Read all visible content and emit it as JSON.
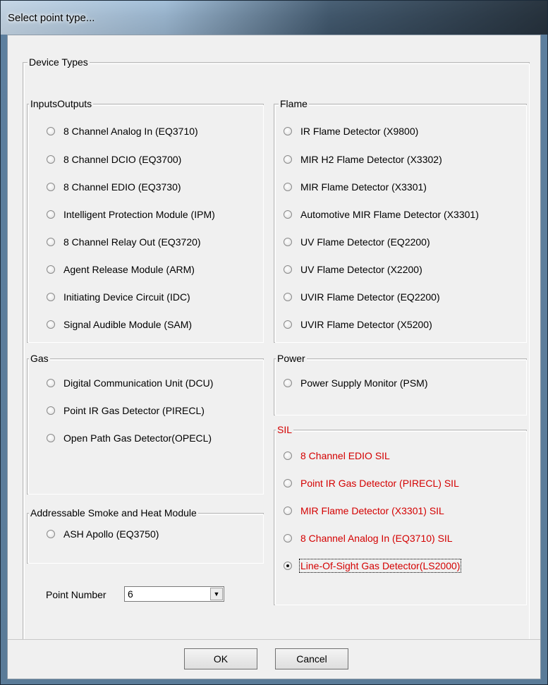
{
  "window": {
    "title": "Select point type..."
  },
  "device_types": {
    "label": "Device Types",
    "groups": {
      "inputs_outputs": {
        "label": "InputsOutputs",
        "options": [
          "8 Channel Analog In (EQ3710)",
          "8 Channel DCIO (EQ3700)",
          "8 Channel EDIO (EQ3730)",
          "Intelligent Protection Module (IPM)",
          "8 Channel Relay Out (EQ3720)",
          "Agent Release Module (ARM)",
          "Initiating Device Circuit (IDC)",
          "Signal Audible Module (SAM)"
        ]
      },
      "flame": {
        "label": "Flame",
        "options": [
          "IR Flame Detector (X9800)",
          "MIR H2 Flame Detector (X3302)",
          "MIR Flame Detector (X3301)",
          "Automotive MIR Flame Detector (X3301)",
          "UV Flame Detector (EQ2200)",
          "UV Flame Detector (X2200)",
          "UVIR Flame Detector (EQ2200)",
          "UVIR Flame Detector (X5200)"
        ]
      },
      "gas": {
        "label": "Gas",
        "options": [
          "Digital Communication Unit (DCU)",
          "Point IR Gas Detector (PIRECL)",
          "Open Path Gas Detector(OPECL)"
        ]
      },
      "power": {
        "label": "Power",
        "options": [
          "Power Supply Monitor (PSM)"
        ]
      },
      "smoke_heat": {
        "label": "Addressable Smoke and Heat Module",
        "options": [
          "ASH Apollo (EQ3750)"
        ]
      },
      "sil": {
        "label": "SIL",
        "options": [
          "8 Channel EDIO SIL",
          "Point IR Gas Detector (PIRECL) SIL",
          "MIR Flame Detector (X3301) SIL",
          "8 Channel Analog In (EQ3710) SIL",
          "Line-Of-Sight Gas Detector(LS2000)"
        ],
        "selected": "Line-Of-Sight Gas Detector(LS2000)"
      }
    }
  },
  "point_number": {
    "label": "Point Number",
    "value": "6"
  },
  "buttons": {
    "ok": "OK",
    "cancel": "Cancel"
  },
  "colors": {
    "sil_text": "#d40000"
  },
  "icons": {
    "dropdown": "chevron-down-icon",
    "radio_selected": "radio-selected-icon"
  }
}
